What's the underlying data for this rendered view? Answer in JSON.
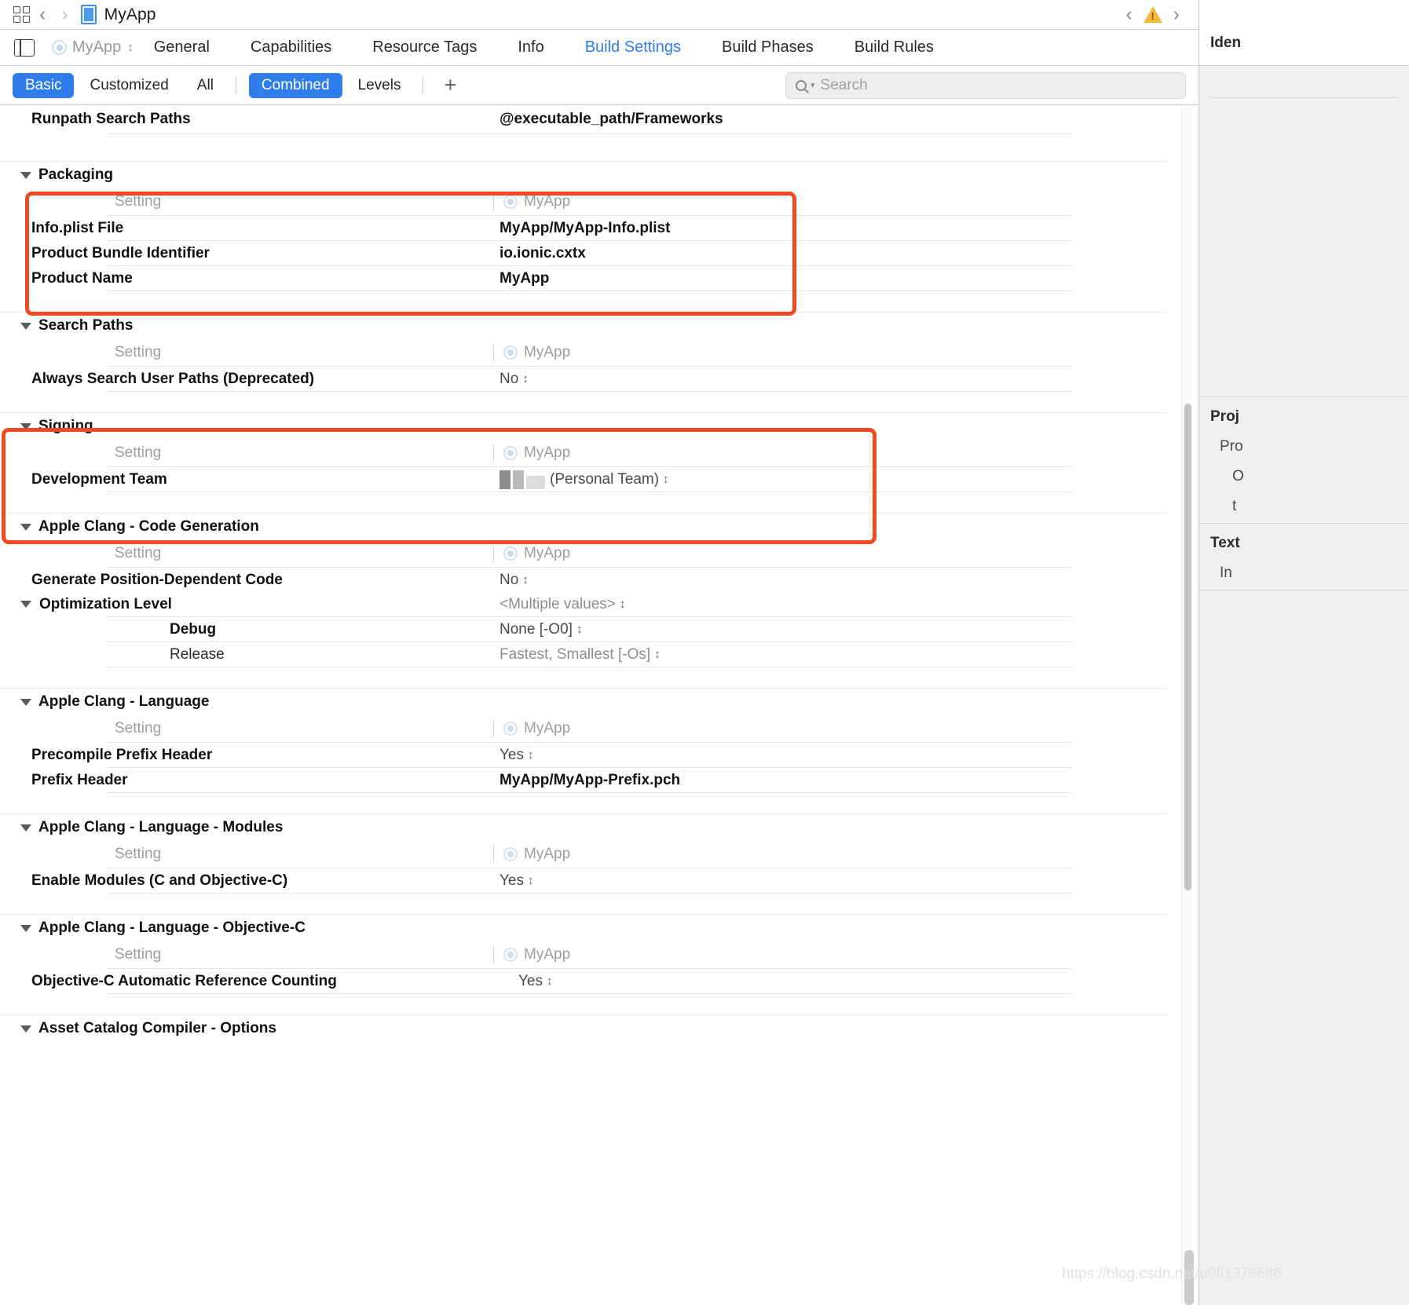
{
  "window": {
    "title": "MyApp",
    "nav_back_icon": "chevron-left-icon",
    "nav_forward_icon": "chevron-right-icon",
    "grid_icon": "grid-icon",
    "document_icon": "document-icon",
    "issue_prev_icon": "chevron-left-icon",
    "issue_warning_icon": "warning-triangle-icon",
    "issue_next_icon": "chevron-right-icon"
  },
  "editor": {
    "panel_toggle_icon": "sidebar-toggle-icon",
    "target_name": "MyApp",
    "target_stepper_icon": "up-down-stepper-icon",
    "tabs": [
      {
        "label": "General",
        "active": false
      },
      {
        "label": "Capabilities",
        "active": false
      },
      {
        "label": "Resource Tags",
        "active": false
      },
      {
        "label": "Info",
        "active": false
      },
      {
        "label": "Build Settings",
        "active": true
      },
      {
        "label": "Build Phases",
        "active": false
      },
      {
        "label": "Build Rules",
        "active": false
      }
    ]
  },
  "filters": {
    "scope": [
      {
        "label": "Basic",
        "active": true
      },
      {
        "label": "Customized",
        "active": false
      },
      {
        "label": "All",
        "active": false
      }
    ],
    "levels": [
      {
        "label": "Combined",
        "active": true
      },
      {
        "label": "Levels",
        "active": false
      }
    ],
    "add_label": "+",
    "search_placeholder": "Search",
    "search_value": "",
    "search_icon": "search-icon"
  },
  "columns": {
    "setting": "Setting",
    "target": "MyApp"
  },
  "top_row": {
    "name": "Runpath Search Paths",
    "value": "@executable_path/Frameworks"
  },
  "sections": [
    {
      "title": "Packaging",
      "highlighted": true,
      "rows": [
        {
          "name": "Info.plist File",
          "value": "MyApp/MyApp-Info.plist",
          "style": "bold",
          "stepper": false
        },
        {
          "name": "Product Bundle Identifier",
          "value": "io.ionic.cxtx",
          "style": "bold",
          "stepper": false
        },
        {
          "name": "Product Name",
          "value": "MyApp",
          "style": "bold",
          "stepper": false
        }
      ]
    },
    {
      "title": "Search Paths",
      "highlighted": false,
      "rows": [
        {
          "name": "Always Search User Paths (Deprecated)",
          "value": "No",
          "style": "semi",
          "stepper": true
        }
      ]
    },
    {
      "title": "Signing",
      "highlighted": true,
      "rows": [
        {
          "name": "Development Team",
          "value": "(Personal Team)",
          "style": "redacted",
          "stepper": true
        }
      ]
    },
    {
      "title": "Apple Clang - Code Generation",
      "highlighted": false,
      "rows": [
        {
          "name": "Generate Position-Dependent Code",
          "value": "No",
          "style": "semi",
          "stepper": true
        },
        {
          "name": "Optimization Level",
          "value": "<Multiple values>",
          "style": "muted",
          "stepper": true,
          "expander": true
        },
        {
          "name": "Debug",
          "value": "None [-O0]",
          "style": "child-bold",
          "stepper": true
        },
        {
          "name": "Release",
          "value": "Fastest, Smallest [-Os]",
          "style": "child-norm",
          "stepper": true
        }
      ]
    },
    {
      "title": "Apple Clang - Language",
      "highlighted": false,
      "rows": [
        {
          "name": "Precompile Prefix Header",
          "value": "Yes",
          "style": "semi",
          "stepper": true
        },
        {
          "name": "Prefix Header",
          "value": "MyApp/MyApp-Prefix.pch",
          "style": "bold",
          "stepper": false
        }
      ]
    },
    {
      "title": "Apple Clang - Language - Modules",
      "highlighted": false,
      "rows": [
        {
          "name": "Enable Modules (C and Objective-C)",
          "value": "Yes",
          "style": "semi",
          "stepper": true
        }
      ]
    },
    {
      "title": "Apple Clang - Language - Objective-C",
      "highlighted": false,
      "rows": [
        {
          "name": "Objective-C Automatic Reference Counting",
          "value": "Yes",
          "style": "semi",
          "stepper": true
        }
      ]
    },
    {
      "title": "Asset Catalog Compiler - Options",
      "highlighted": false,
      "rows": []
    }
  ],
  "inspector": {
    "identity_header": "Iden",
    "project_header": "Proj",
    "project_row1": "Pro",
    "project_row2": "O",
    "project_row3": "t",
    "text_header": "Text",
    "text_row1": "In"
  },
  "watermark": "https://blog.csdn.net/u0fi1376686",
  "colors": {
    "accent": "#2f7dea",
    "annotation": "#f04a22",
    "warning": "#f5b93a",
    "muted_text": "#9e9e9e"
  }
}
